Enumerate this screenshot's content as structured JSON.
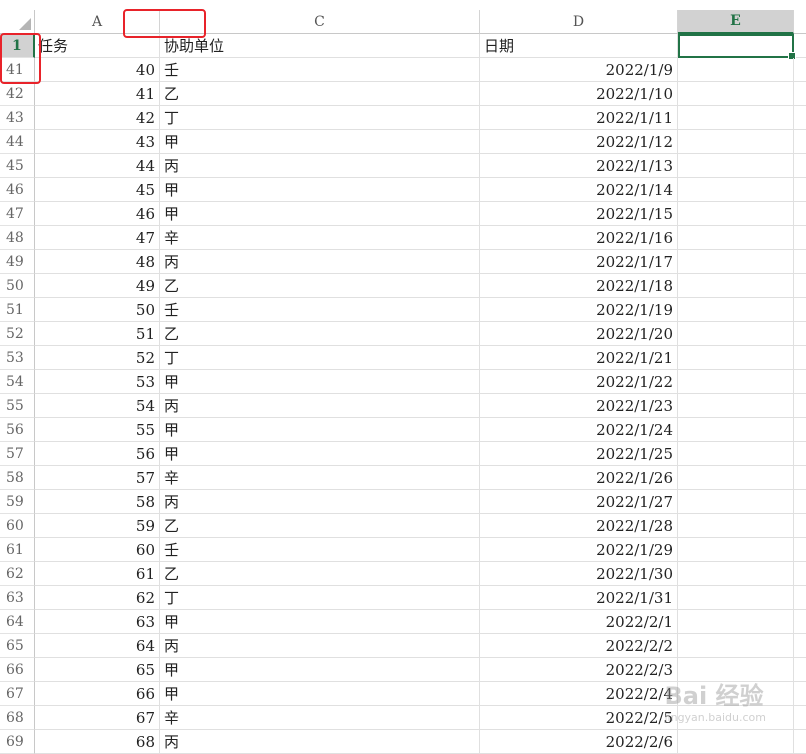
{
  "columns": [
    "A",
    "",
    "C",
    "D",
    "E"
  ],
  "header_row": {
    "row_number": "1",
    "A": "任务",
    "C": "协助单位",
    "D": "日期"
  },
  "rows": [
    {
      "row": "41",
      "task": "40",
      "unit": "壬",
      "date": "2022/1/9"
    },
    {
      "row": "42",
      "task": "41",
      "unit": "乙",
      "date": "2022/1/10"
    },
    {
      "row": "43",
      "task": "42",
      "unit": "丁",
      "date": "2022/1/11"
    },
    {
      "row": "44",
      "task": "43",
      "unit": "甲",
      "date": "2022/1/12"
    },
    {
      "row": "45",
      "task": "44",
      "unit": "丙",
      "date": "2022/1/13"
    },
    {
      "row": "46",
      "task": "45",
      "unit": "甲",
      "date": "2022/1/14"
    },
    {
      "row": "47",
      "task": "46",
      "unit": "甲",
      "date": "2022/1/15"
    },
    {
      "row": "48",
      "task": "47",
      "unit": "辛",
      "date": "2022/1/16"
    },
    {
      "row": "49",
      "task": "48",
      "unit": "丙",
      "date": "2022/1/17"
    },
    {
      "row": "50",
      "task": "49",
      "unit": "乙",
      "date": "2022/1/18"
    },
    {
      "row": "51",
      "task": "50",
      "unit": "壬",
      "date": "2022/1/19"
    },
    {
      "row": "52",
      "task": "51",
      "unit": "乙",
      "date": "2022/1/20"
    },
    {
      "row": "53",
      "task": "52",
      "unit": "丁",
      "date": "2022/1/21"
    },
    {
      "row": "54",
      "task": "53",
      "unit": "甲",
      "date": "2022/1/22"
    },
    {
      "row": "55",
      "task": "54",
      "unit": "丙",
      "date": "2022/1/23"
    },
    {
      "row": "56",
      "task": "55",
      "unit": "甲",
      "date": "2022/1/24"
    },
    {
      "row": "57",
      "task": "56",
      "unit": "甲",
      "date": "2022/1/25"
    },
    {
      "row": "58",
      "task": "57",
      "unit": "辛",
      "date": "2022/1/26"
    },
    {
      "row": "59",
      "task": "58",
      "unit": "丙",
      "date": "2022/1/27"
    },
    {
      "row": "60",
      "task": "59",
      "unit": "乙",
      "date": "2022/1/28"
    },
    {
      "row": "61",
      "task": "60",
      "unit": "壬",
      "date": "2022/1/29"
    },
    {
      "row": "62",
      "task": "61",
      "unit": "乙",
      "date": "2022/1/30"
    },
    {
      "row": "63",
      "task": "62",
      "unit": "丁",
      "date": "2022/1/31"
    },
    {
      "row": "64",
      "task": "63",
      "unit": "甲",
      "date": "2022/2/1"
    },
    {
      "row": "65",
      "task": "64",
      "unit": "丙",
      "date": "2022/2/2"
    },
    {
      "row": "66",
      "task": "65",
      "unit": "甲",
      "date": "2022/2/3"
    },
    {
      "row": "67",
      "task": "66",
      "unit": "甲",
      "date": "2022/2/4"
    },
    {
      "row": "68",
      "task": "67",
      "unit": "辛",
      "date": "2022/2/5"
    },
    {
      "row": "69",
      "task": "68",
      "unit": "丙",
      "date": "2022/2/6"
    }
  ],
  "watermark": {
    "text": "Bai 经验",
    "sub": "jingyan.baidu.com"
  },
  "colors": {
    "selection_green": "#217346",
    "highlight_red": "#e8232a"
  }
}
